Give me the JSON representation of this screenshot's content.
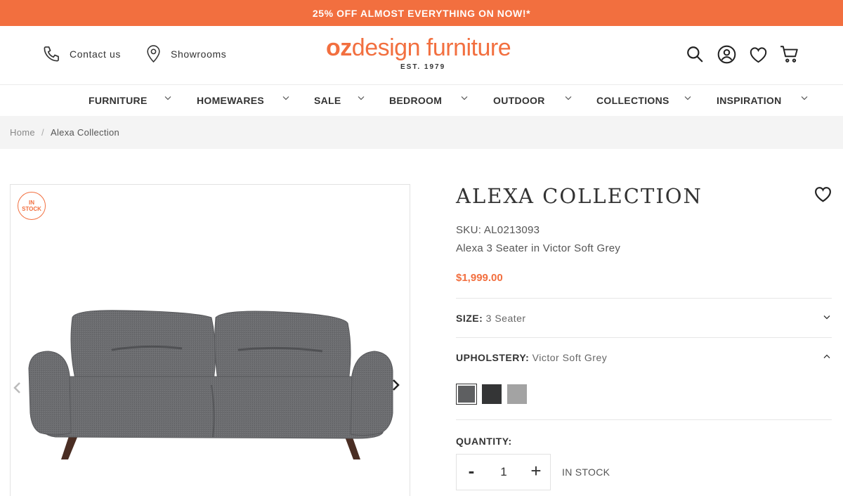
{
  "promo": {
    "text": "25% OFF ALMOST EVERYTHING ON NOW!*"
  },
  "header": {
    "contact_label": "Contact us",
    "showrooms_label": "Showrooms",
    "logo_text_bold": "oz",
    "logo_text_rest": "design furniture",
    "logo_est": "EST. 1979",
    "icons": [
      "search-icon",
      "account-icon",
      "wishlist-icon",
      "cart-icon"
    ]
  },
  "nav": {
    "items": [
      {
        "label": "FURNITURE"
      },
      {
        "label": "HOMEWARES"
      },
      {
        "label": "SALE"
      },
      {
        "label": "BEDROOM"
      },
      {
        "label": "OUTDOOR"
      },
      {
        "label": "COLLECTIONS"
      },
      {
        "label": "INSPIRATION"
      }
    ]
  },
  "breadcrumb": {
    "home": "Home",
    "separator": "/",
    "current": "Alexa Collection"
  },
  "gallery": {
    "badge_line1": "IN",
    "badge_line2": "STOCK"
  },
  "product": {
    "title": "ALEXA COLLECTION",
    "sku": "SKU: AL0213093",
    "description": "Alexa 3 Seater in Victor Soft Grey",
    "price": "$1,999.00",
    "size_label": "SIZE:",
    "size_value": "3 Seater",
    "upholstery_label": "UPHOLSTERY:",
    "upholstery_value": "Victor Soft Grey",
    "swatches": [
      {
        "name": "Victor Soft Grey",
        "color": "#5e5f61",
        "selected": true
      },
      {
        "name": "Charcoal",
        "color": "#343536",
        "selected": false
      },
      {
        "name": "Light Grey",
        "color": "#a3a3a3",
        "selected": false
      }
    ],
    "quantity_label": "QUANTITY:",
    "quantity_minus": "-",
    "quantity_plus": "+",
    "quantity_value": "1",
    "stock_status": "IN STOCK"
  },
  "colors": {
    "accent": "#f26f3f",
    "text": "#333333",
    "breadcrumb_bg": "#f4f4f4"
  }
}
